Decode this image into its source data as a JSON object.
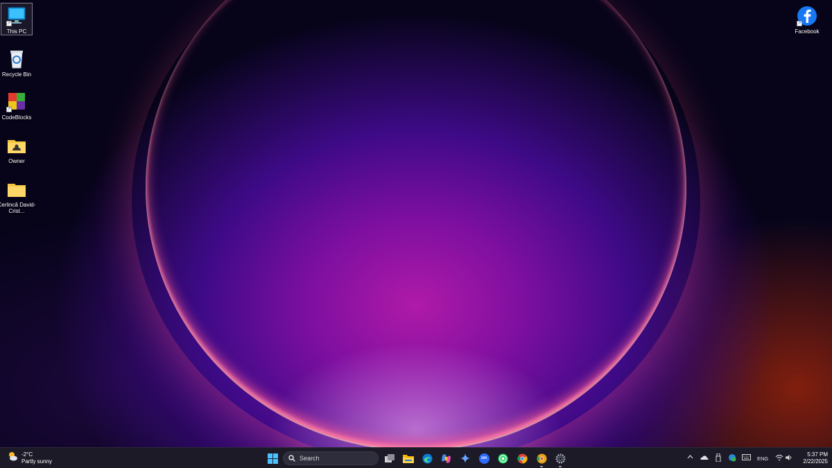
{
  "desktop": {
    "icons_left": [
      {
        "label": "This PC",
        "icon": "this-pc-icon",
        "selected": true
      },
      {
        "label": "Recycle Bin",
        "icon": "recycle-bin-icon"
      },
      {
        "label": "CodeBlocks",
        "icon": "codeblocks-icon"
      },
      {
        "label": "Owner",
        "icon": "user-folder-icon"
      },
      {
        "label": "Cerlincă David-Crist...",
        "icon": "folder-icon"
      }
    ],
    "icon_right": {
      "label": "Facebook",
      "icon": "facebook-icon"
    }
  },
  "taskbar": {
    "weather": {
      "temp": "-2°C",
      "condition": "Partly sunny",
      "icon": "partly-sunny-icon"
    },
    "search_placeholder": "Search",
    "pinned": [
      "start-icon",
      "task-view-icon",
      "file-explorer-icon",
      "edge-icon",
      "copilot-icon",
      "gemini-icon",
      "zoom-icon",
      "whatsapp-icon",
      "chrome-icon",
      "chrome-canary-icon",
      "settings-icon"
    ],
    "zoom_glyph": "zm",
    "tray": {
      "language": "ENG",
      "time": "5:37 PM",
      "date": "2/22/2025"
    }
  }
}
